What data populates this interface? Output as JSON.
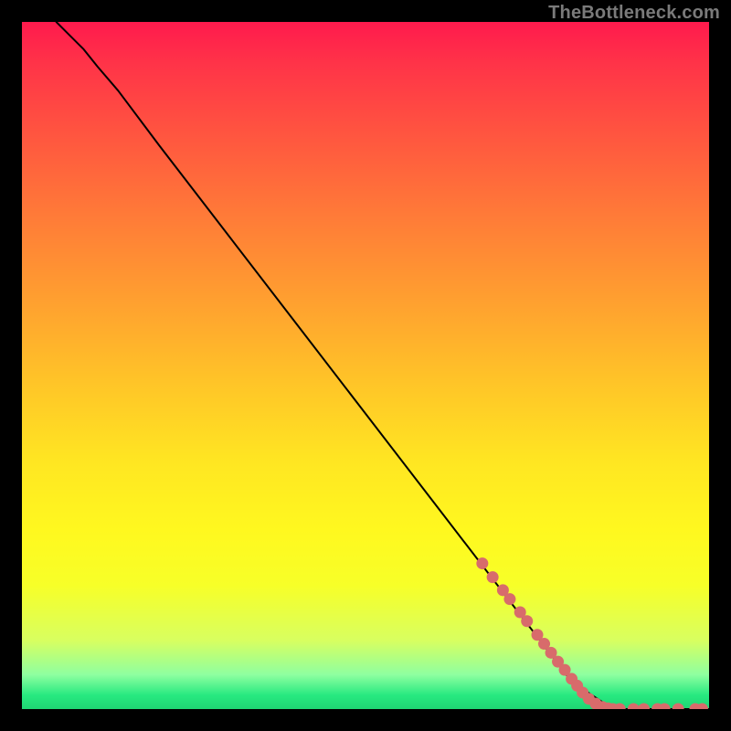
{
  "watermark": "TheBottleneck.com",
  "chart_data": {
    "type": "line",
    "title": "",
    "xlabel": "",
    "ylabel": "",
    "xlim": [
      0,
      100
    ],
    "ylim": [
      0,
      100
    ],
    "grid": false,
    "series": [
      {
        "name": "curve",
        "x": [
          5,
          7,
          9,
          11,
          14,
          20,
          30,
          40,
          50,
          60,
          70,
          80,
          86,
          90,
          94,
          98,
          100
        ],
        "y": [
          100,
          98,
          96,
          93.5,
          90,
          82,
          69,
          56,
          43,
          30,
          17,
          4,
          0,
          0,
          0,
          0,
          0
        ]
      }
    ],
    "marker_points": {
      "name": "dots",
      "x": [
        67,
        68.5,
        70,
        71,
        72.5,
        73.5,
        75,
        76,
        77,
        78,
        79,
        80,
        80.8,
        81.6,
        82.5,
        83.5,
        84.5,
        85.3,
        86,
        87,
        89,
        90.5,
        92.5,
        93.5,
        95.5,
        98,
        99
      ],
      "y": [
        21.2,
        19.2,
        17.3,
        16,
        14.1,
        12.8,
        10.8,
        9.5,
        8.2,
        6.9,
        5.7,
        4.4,
        3.4,
        2.4,
        1.5,
        0.8,
        0.3,
        0.1,
        0,
        0,
        0,
        0,
        0,
        0,
        0,
        0,
        0
      ]
    },
    "marker_color": "#d86b6b",
    "line_color": "#000000"
  }
}
